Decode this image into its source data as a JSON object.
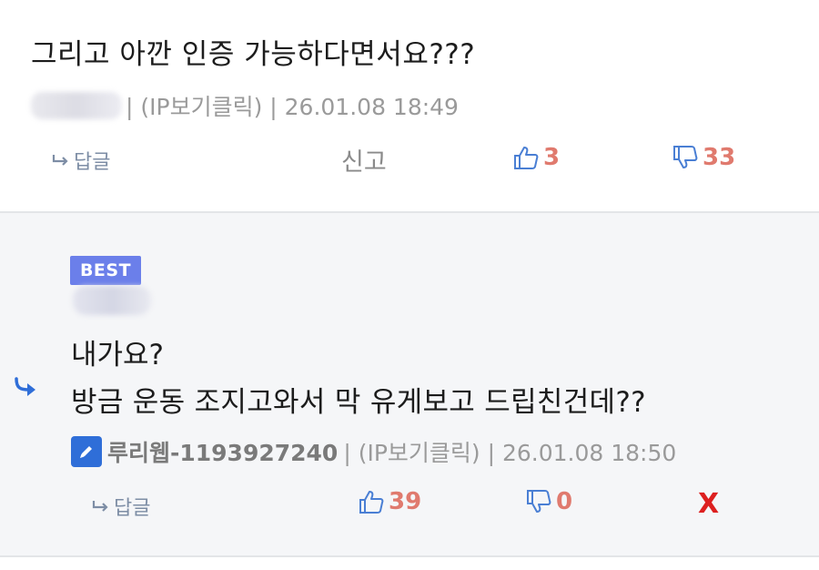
{
  "comment1": {
    "text": "그리고 아깐 인증 가능하다면서요???",
    "meta": "| (IP보기클릭) | 26.01.08 18:49",
    "reply_label": "답글",
    "report_label": "신고",
    "likes": "3",
    "dislikes": "33"
  },
  "comment2": {
    "badge": "BEST",
    "line1": "내가요?",
    "line2": "방금 운동 조지고와서 막 유게보고 드립친건데??",
    "author": "루리웹-1193927240",
    "meta": "| (IP보기클릭) | 26.01.08 18:50",
    "reply_label": "답글",
    "likes": "39",
    "dislikes": "0",
    "delete_label": "X"
  },
  "colors": {
    "vote": "#e07a6e",
    "vote_icon": "#4a7fd4",
    "best_badge": "#6b7fea",
    "author_badge": "#2f6ed8",
    "delete": "#dd2020"
  },
  "icons": [
    "reply-arrow-icon",
    "thumbs-up-icon",
    "thumbs-down-icon",
    "pencil-icon"
  ]
}
